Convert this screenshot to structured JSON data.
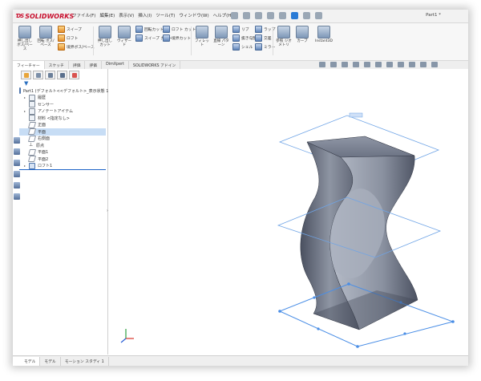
{
  "app": {
    "brand": "SOLIDWORKS",
    "document_title": "Part1 *"
  },
  "menu": [
    "ファイル(F)",
    "編集(E)",
    "表示(V)",
    "挿入(I)",
    "ツール(T)",
    "ウィンドウ(W)",
    "ヘルプ(H)"
  ],
  "command_manager": {
    "extrude_boss": "押し出し ボス/ベース",
    "revolve_boss": "回転 ボス/ベース",
    "sweep": "スイープ",
    "loft": "ロフト",
    "boundary_boss": "境界ボス/ベース",
    "extrude_cut": "押し出し カット",
    "wizard": "ウィザード",
    "revolve_cut": "回転カット",
    "sweep_cut": "スイープ カット",
    "loft_cut": "ロフト カット",
    "boundary_cut": "境界カット",
    "fillet": "フィレット",
    "linear_pattern": "直線 パターン",
    "rib": "リブ",
    "draft": "抜き勾配",
    "shell": "シェル",
    "wrap": "ラップ",
    "intersect": "交差",
    "mirror": "ミラー",
    "ref_geometry": "参照 ジオメトリ",
    "curves": "カーブ",
    "instant3d": "Instant3D"
  },
  "tabs": [
    "フィーチャー",
    "スケッチ",
    "評価",
    "評価",
    "DimXpert",
    "SOLIDWORKS アドイン"
  ],
  "tree": {
    "root": "Part1 (デフォルト<<デフォルト>_表示状態 1>)",
    "items": [
      "履歴",
      "センサー",
      "アノテートアイテム",
      "材料 <指定なし>",
      "正面",
      "平面",
      "右側面",
      "原点",
      "平面1",
      "平面2",
      "ロフト1"
    ]
  },
  "bottom_tabs": [
    "モデル",
    "モデル",
    "モーション スタディ 1"
  ],
  "colors": {
    "accent": "#2a7bd6",
    "plane_line": "#6fa4e6",
    "selected_item": "#c7ddf5",
    "model_face_light": "#a6adbb",
    "model_face_dark": "#3c4150"
  }
}
